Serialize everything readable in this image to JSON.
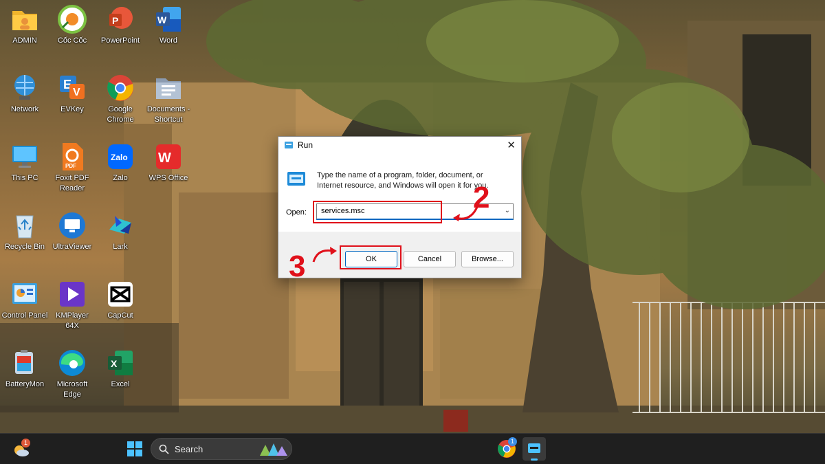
{
  "desktop": {
    "icons": [
      {
        "label": "ADMIN"
      },
      {
        "label": "Cốc Cốc"
      },
      {
        "label": "PowerPoint"
      },
      {
        "label": "Word"
      },
      {
        "label": "Network"
      },
      {
        "label": "EVKey"
      },
      {
        "label": "Google Chrome"
      },
      {
        "label": "Documents - Shortcut"
      },
      {
        "label": "This PC"
      },
      {
        "label": "Foxit PDF Reader"
      },
      {
        "label": "Zalo"
      },
      {
        "label": "WPS Office"
      },
      {
        "label": "Recycle Bin"
      },
      {
        "label": "UltraViewer"
      },
      {
        "label": "Lark"
      },
      {
        "label": "Control Panel"
      },
      {
        "label": "KMPlayer 64X"
      },
      {
        "label": "CapCut"
      },
      {
        "label": "BatteryMon"
      },
      {
        "label": "Microsoft Edge"
      },
      {
        "label": "Excel"
      }
    ]
  },
  "run_dialog": {
    "title": "Run",
    "close_glyph": "✕",
    "description": "Type the name of a program, folder, document, or Internet resource, and Windows will open it for you.",
    "open_label": "Open:",
    "open_value": "services.msc",
    "ok_label": "OK",
    "cancel_label": "Cancel",
    "browse_label": "Browse..."
  },
  "annotations": {
    "step2": "2",
    "step3": "3",
    "highlight_color": "#e0101a"
  },
  "taskbar": {
    "search_placeholder": "Search",
    "weather_badge": "1",
    "chrome_badge": "1"
  }
}
